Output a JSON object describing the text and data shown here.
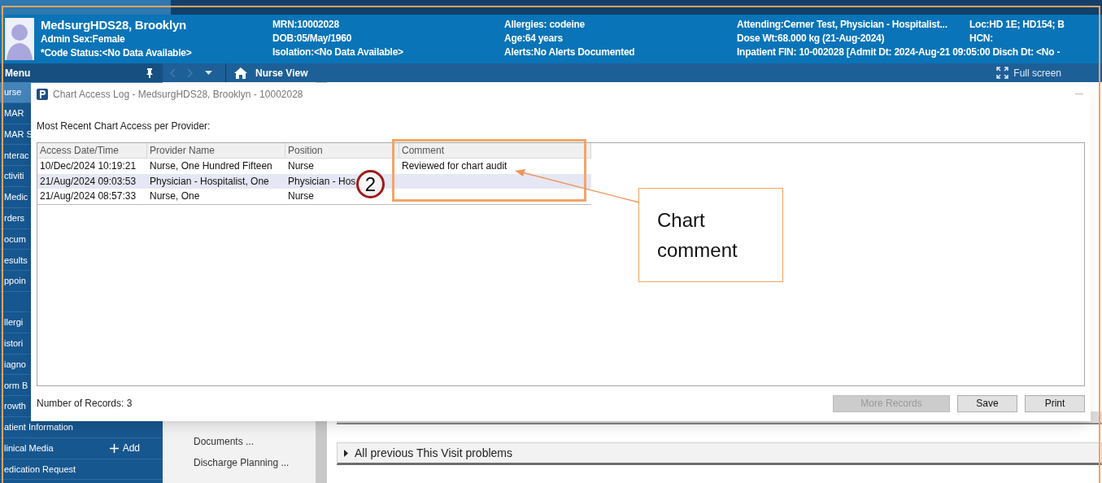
{
  "banner": {
    "columns": [
      {
        "lines": [
          "MedsurgHDS28, Brooklyn",
          "Admin Sex:Female",
          "*Code Status:<No Data Available>"
        ]
      },
      {
        "lines": [
          "MRN:10002028",
          "DOB:05/May/1960",
          "Isolation:<No Data Available>"
        ]
      },
      {
        "lines": [
          "Allergies: codeine",
          "Age:64 years",
          "Alerts:No Alerts Documented"
        ]
      },
      {
        "lines": [
          "Attending:Cerner Test, Physician - Hospitalist...",
          "Dose Wt:68.000 kg (21-Aug-2024)",
          "Inpatient FIN: 10-002028 [Admit Dt: 2024-Aug-21 09:05:00 Disch Dt: <No -"
        ]
      },
      {
        "lines": [
          "Loc:HD 1E; HD154; B",
          "HCN:"
        ]
      }
    ]
  },
  "toolbar": {
    "menu_label": "Menu",
    "view_title": "Nurse View",
    "fullscreen_label": "Full screen"
  },
  "sidebar": {
    "sections": [
      {
        "items": [
          {
            "label": "urse",
            "selected": true
          },
          {
            "label": "MAR",
            "selected": false
          },
          {
            "label": "MAR S",
            "selected": false
          },
          {
            "label": "nterac",
            "selected": false
          },
          {
            "label": "ctiviti",
            "selected": false
          },
          {
            "label": "Medic",
            "selected": false
          },
          {
            "label": "rders",
            "selected": false
          },
          {
            "label": "ocum",
            "selected": false
          },
          {
            "label": "esults",
            "selected": false
          },
          {
            "label": "ppoin",
            "selected": false
          }
        ]
      },
      {
        "items": [
          {
            "label": "llergi",
            "selected": false
          },
          {
            "label": "istori",
            "selected": false
          },
          {
            "label": "iagno",
            "selected": false
          },
          {
            "label": "orm B",
            "selected": false
          },
          {
            "label": "rowth",
            "selected": false
          },
          {
            "label": "atient Information",
            "selected": false
          },
          {
            "label": "linical Media",
            "selected": false,
            "action": "Add"
          },
          {
            "label": "edication Request",
            "selected": false
          }
        ]
      }
    ]
  },
  "middle_pane": {
    "items": [
      "Documents ...",
      "Discharge Planning ..."
    ]
  },
  "problem_sections": [
    {
      "label": "All previous This Visit problems",
      "expanded": false
    }
  ],
  "dialog": {
    "title": "Chart Access Log - MedsurgHDS28, Brooklyn - 10002028",
    "subtitle": "Most Recent Chart Access per Provider:",
    "table": {
      "columns": [
        "Access Date/Time",
        "Provider Name",
        "Position",
        "Comment"
      ],
      "rows": [
        {
          "cells": [
            "10/Dec/2024 10:19:21",
            "Nurse, One Hundred Fifteen",
            "Nurse",
            "Reviewed for chart audit"
          ],
          "selected": false
        },
        {
          "cells": [
            "21/Aug/2024 09:03:53",
            "Physician - Hospitalist, One",
            "Physician - Hos",
            ""
          ],
          "selected": true
        },
        {
          "cells": [
            "21/Aug/2024 08:57:33",
            "Nurse, One",
            "Nurse",
            ""
          ],
          "selected": false
        }
      ]
    },
    "record_count": "Number of Records: 3",
    "buttons": [
      {
        "label": "More Records",
        "disabled": true
      },
      {
        "label": "Save",
        "disabled": false
      },
      {
        "label": "Print",
        "disabled": false
      }
    ]
  },
  "annotation": {
    "marker": "2",
    "callout": "Chart comment"
  }
}
